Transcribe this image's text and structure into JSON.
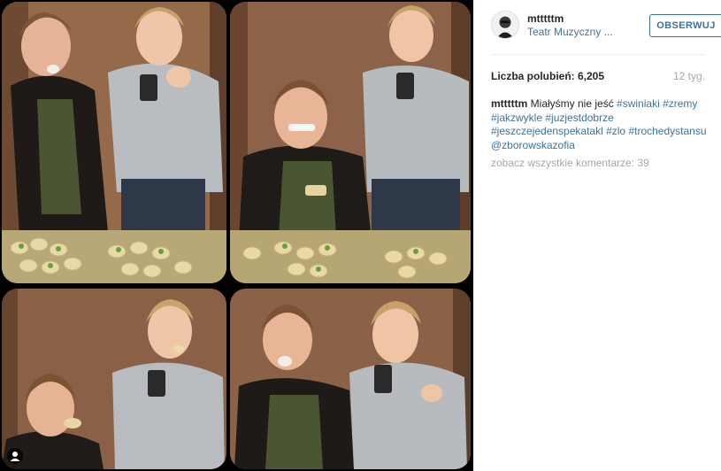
{
  "post": {
    "username": "mtttttm",
    "location": "Teatr Muzyczny ...",
    "follow_label": "OBSERWUJ",
    "likes_label": "Liczba polubień: 6,205",
    "timestamp": "12 tyg.",
    "caption": {
      "text": "Miałyśmy nie jeść",
      "hashtags": [
        "#swiniaki",
        "#zremy",
        "#jakzwykle",
        "#juzjestdobrze",
        "#jeszczejedenspekatakl",
        "#zlo",
        "#trochedystansu"
      ],
      "mention": "@zborowskazofia"
    },
    "comments_link": "zobacz wszystkie komentarze: 39"
  },
  "photo": {
    "tiles": 4,
    "user_tag_icon": "person-icon"
  },
  "colors": {
    "link": "#3f729b",
    "muted": "#a5a7aa",
    "text": "#262626"
  }
}
